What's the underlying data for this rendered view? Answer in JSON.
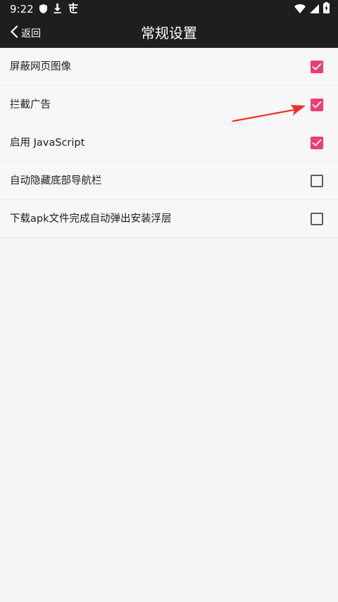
{
  "status_bar": {
    "time": "9:22",
    "icons": [
      "shield-icon",
      "download-icon",
      "app-notification-icon",
      "wifi-icon",
      "signal-icon",
      "battery-charging-icon"
    ]
  },
  "app_bar": {
    "back_label": "返回",
    "title": "常规设置"
  },
  "settings": [
    {
      "label": "屏蔽网页图像",
      "checked": true
    },
    {
      "label": "拦截广告",
      "checked": true
    },
    {
      "label": "启用 JavaScript",
      "checked": true
    },
    {
      "label": "自动隐藏底部导航栏",
      "checked": false
    },
    {
      "label": "下载apk文件完成自动弹出安装浮层",
      "checked": false
    }
  ],
  "annotation": {
    "arrow_color": "#e8352c",
    "points_to": "拦截广告"
  },
  "colors": {
    "bar_background": "#1e1e1e",
    "checkbox_accent": "#ee3d72",
    "page_background": "#f4f4f4"
  }
}
